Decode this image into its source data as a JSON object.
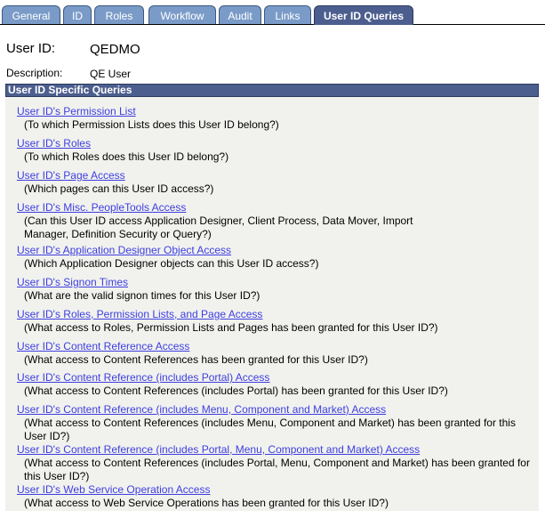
{
  "tabs": [
    {
      "label": "General",
      "active": false
    },
    {
      "label": "ID",
      "active": false
    },
    {
      "label": "Roles",
      "active": false
    },
    {
      "label": "Workflow",
      "active": false
    },
    {
      "label": "Audit",
      "active": false
    },
    {
      "label": "Links",
      "active": false
    },
    {
      "label": "User ID Queries",
      "active": true
    }
  ],
  "user": {
    "id_label": "User ID:",
    "id_value": "QEDMO",
    "description_label": "Description:",
    "description_value": "QE User"
  },
  "section": {
    "title": "User ID Specific Queries",
    "queries": [
      {
        "link": "User ID's Permission List",
        "description": "(To which Permission Lists does this User ID belong?)"
      },
      {
        "link": "User ID's Roles",
        "description": "(To which Roles does this User ID belong?)"
      },
      {
        "link": "User ID's Page Access",
        "description": "(Which pages can this User ID access?)"
      },
      {
        "link": "User ID's Misc. PeopleTools Access",
        "description": "(Can this User ID access Application Designer, Client Process, Data Mover, Import Manager, Definition Security or Query?)"
      },
      {
        "link": "User ID's Application Designer Object Access",
        "description": "(Which Application Designer objects can this User ID access?)"
      },
      {
        "link": "User ID's Signon Times",
        "description": "(What are the valid signon times for this User ID?)"
      },
      {
        "link": "User ID's Roles, Permission Lists, and Page Access",
        "description": "(What access to Roles, Permission Lists and Pages has been granted for this User ID?)"
      },
      {
        "link": "User ID's Content Reference Access",
        "description": "(What access to Content References has been granted for this User ID?)"
      },
      {
        "link": "User ID's Content Reference (includes Portal) Access",
        "description": "(What access to Content References (includes Portal) has been granted for this User ID?)"
      },
      {
        "link": "User ID's Content Reference (includes Menu, Component and Market) Access",
        "description": "(What access to Content References (includes Menu, Component and Market) has been granted for this User ID?)"
      },
      {
        "link": "User ID's Content Reference (includes Portal, Menu, Component and Market) Access",
        "description": "(What access to Content References (includes Portal, Menu, Component and Market) has been granted for this User ID?)"
      },
      {
        "link": "User ID's Web Service Operation Access",
        "description": "(What access to Web Service Operations has been granted for this User ID?)"
      }
    ]
  }
}
